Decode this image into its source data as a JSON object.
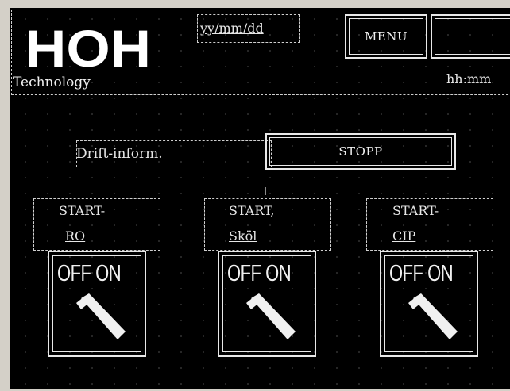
{
  "header": {
    "logo_text": "HOH",
    "logo_subtitle": "Technology",
    "date_format": "yy/mm/dd",
    "time_format": "hh:mm",
    "menu_label": "MENU"
  },
  "status": {
    "label": "Drift-inform.",
    "value": "STOPP"
  },
  "controls": [
    {
      "line1": "START-",
      "line2": "RO",
      "switch_label": "OFF ON"
    },
    {
      "line1": "START,",
      "line2": "Sköl",
      "switch_label": "OFF ON"
    },
    {
      "line1": "START-",
      "line2": "CIP",
      "switch_label": "OFF ON"
    }
  ],
  "colors": {
    "background": "#000000",
    "foreground": "#e8e8e8",
    "window_frame": "#d4d0c8"
  }
}
